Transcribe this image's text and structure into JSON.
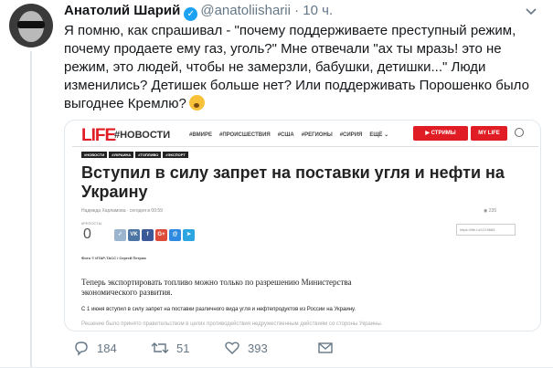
{
  "tweet": {
    "author_name": "Анатолий Шарий",
    "handle": "@anatoliisharii",
    "separator": "·",
    "time": "10 ч.",
    "text": "Я помню, как спрашивал - \"почему поддерживаете преступный режим, почему продаете ему газ, уголь?\" Мне отвечали \"ах ты мразь! это не режим, это людей, чтобы не замерзли, бабушки, детишки...\" Люди изменились? Детишек больше нет? Или поддерживать Порошенко было выгоднее Кремлю?",
    "replies": "184",
    "retweets": "51",
    "likes": "393"
  },
  "article": {
    "logo": "LIFE",
    "section": "#НОВОСТИ",
    "nav_items": [
      "#ВМИРЕ",
      "#ПРОИСШЕСТВИЯ",
      "#США",
      "#РЕГИОНЫ",
      "#СИРИЯ",
      "ЕЩЁ ⌄"
    ],
    "streams_button": "▶ СТРИМЫ",
    "mylife_button": "MY LIFE",
    "tags": [
      "#НОВОСТИ",
      "#УКРАИНА",
      "#ТОПЛИВО",
      "#ЭКСПОРТ"
    ],
    "headline": "Вступил в силу запрет на поставки угля и нефти на Украину",
    "meta": "Надежда Харламова · сегодня в 00:59",
    "views": "◉ 235",
    "reposts_label": "#РЕПОСТЫ",
    "reposts_count": "0",
    "share_buttons": [
      "✓",
      "VK",
      "f",
      "G+",
      "@",
      "➤"
    ],
    "short_url": "https://life.ru/1219685",
    "photo_credit": "Фото © ИТАР-ТАСС / Сергей Петров",
    "lead": "Теперь экспортировать топливо можно только по разрешению Министерства экономического развития.",
    "paragraph": "С 1 июня вступил в силу запрет на поставки различного вида угля и нефтепродуктов из России на Украину.",
    "paragraph2": "Решение было принято правительством в целях противодействия недружественным действиям со стороны Украины."
  },
  "colors": {
    "twitter_blue": "#1da1f2",
    "life_red": "#e01c24",
    "muted": "#657786"
  }
}
